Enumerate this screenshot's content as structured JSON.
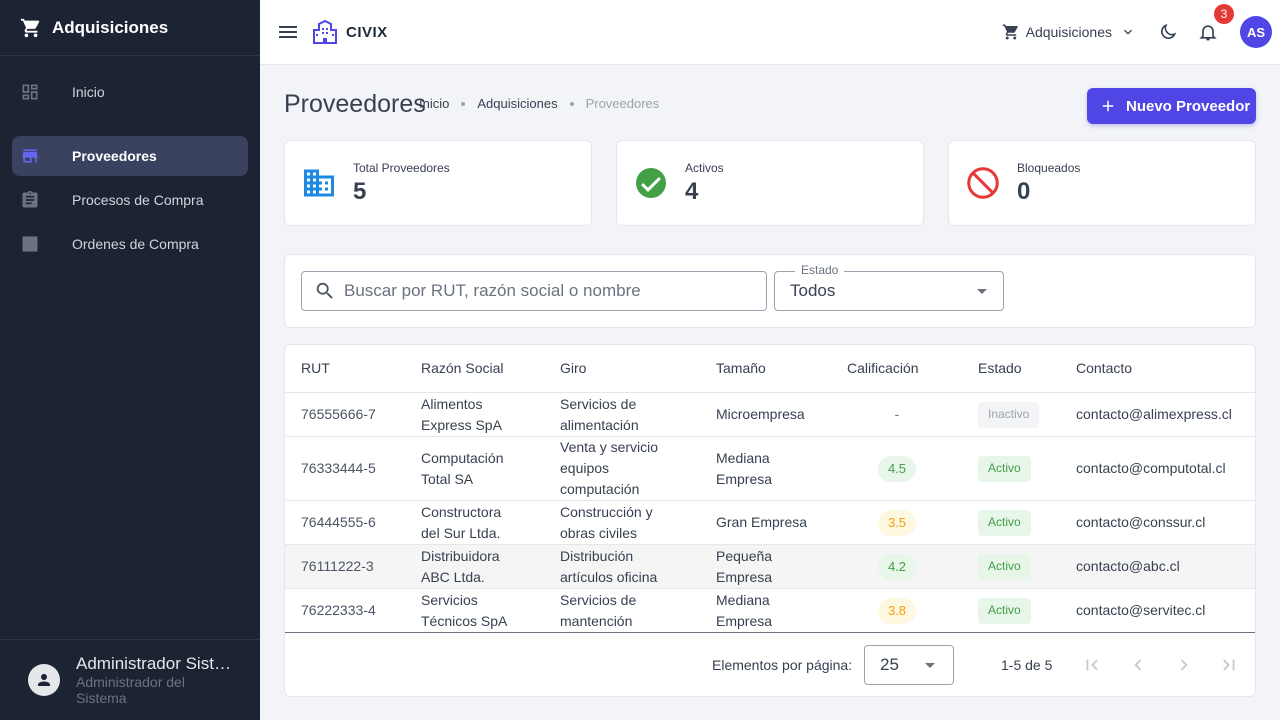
{
  "sidebar": {
    "title": "Adquisiciones",
    "items": [
      {
        "label": "Inicio",
        "icon": "dashboard-icon"
      },
      {
        "label": "Proveedores",
        "icon": "store-icon"
      },
      {
        "label": "Procesos de Compra",
        "icon": "clipboard-icon"
      },
      {
        "label": "Ordenes de Compra",
        "icon": "receipt-icon"
      }
    ],
    "user": {
      "name": "Administrador Sistema",
      "role": "Administrador del Sistema"
    }
  },
  "topbar": {
    "brand": "CIVIX",
    "module": "Adquisiciones",
    "notifications": "3",
    "avatar_initials": "AS"
  },
  "page": {
    "title": "Proveedores",
    "breadcrumb": [
      "Inicio",
      "Adquisiciones",
      "Proveedores"
    ],
    "new_button": "Nuevo Proveedor"
  },
  "stats": [
    {
      "label": "Total Proveedores",
      "value": "5",
      "icon": "building-icon",
      "color": "#1e88e5"
    },
    {
      "label": "Activos",
      "value": "4",
      "icon": "check-circle-icon",
      "color": "#43a047"
    },
    {
      "label": "Bloqueados",
      "value": "0",
      "icon": "block-icon",
      "color": "#e53935"
    }
  ],
  "filters": {
    "search_placeholder": "Buscar por RUT, razón social o nombre",
    "search_value": "",
    "status_label": "Estado",
    "status_value": "Todos"
  },
  "table": {
    "columns": [
      "RUT",
      "Razón Social",
      "Giro",
      "Tamaño",
      "Calificación",
      "Estado",
      "Contacto"
    ],
    "rows": [
      {
        "rut": "76555666-7",
        "razon": [
          "Alimentos",
          "Express SpA"
        ],
        "giro": [
          "Servicios de",
          "alimentación"
        ],
        "tamano": [
          "Microempresa"
        ],
        "calif": "-",
        "calif_type": "none",
        "estado": "Inactivo",
        "estado_type": "inact",
        "contacto": "contacto@alimexpress.cl"
      },
      {
        "rut": "76333444-5",
        "razon": [
          "Computación",
          "Total SA"
        ],
        "giro": [
          "Venta y servicio",
          "equipos",
          "computación"
        ],
        "tamano": [
          "Mediana",
          "Empresa"
        ],
        "calif": "4.5",
        "calif_type": "green",
        "estado": "Activo",
        "estado_type": "act",
        "contacto": "contacto@computotal.cl"
      },
      {
        "rut": "76444555-6",
        "razon": [
          "Constructora",
          "del Sur Ltda."
        ],
        "giro": [
          "Construcción y",
          "obras civiles"
        ],
        "tamano": [
          "Gran Empresa"
        ],
        "calif": "3.5",
        "calif_type": "amber",
        "estado": "Activo",
        "estado_type": "act",
        "contacto": "contacto@conssur.cl"
      },
      {
        "rut": "76111222-3",
        "razon": [
          "Distribuidora",
          "ABC Ltda."
        ],
        "giro": [
          "Distribución",
          "artículos oficina"
        ],
        "tamano": [
          "Pequeña",
          "Empresa"
        ],
        "calif": "4.2",
        "calif_type": "green",
        "estado": "Activo",
        "estado_type": "act",
        "contacto": "contacto@abc.cl"
      },
      {
        "rut": "76222333-4",
        "razon": [
          "Servicios",
          "Técnicos SpA"
        ],
        "giro": [
          "Servicios de",
          "mantención"
        ],
        "tamano": [
          "Mediana",
          "Empresa"
        ],
        "calif": "3.8",
        "calif_type": "amber",
        "estado": "Activo",
        "estado_type": "act",
        "contacto": "contacto@servitec.cl"
      }
    ]
  },
  "paginator": {
    "label": "Elementos por página:",
    "page_size": "25",
    "range": "1-5 de 5"
  },
  "colors": {
    "primary": "#4f46e5",
    "sidebar": "#1c2434",
    "success": "#43a047",
    "warning": "#f59e0b",
    "danger": "#e53935"
  }
}
